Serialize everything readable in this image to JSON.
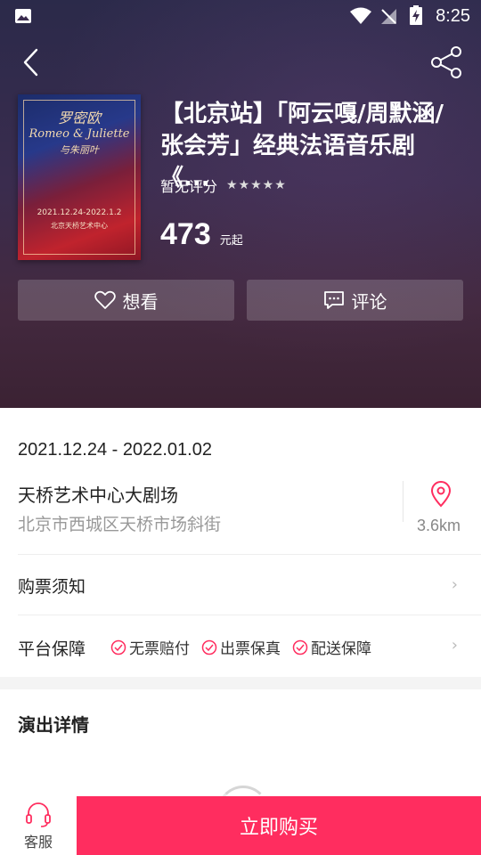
{
  "status_bar": {
    "time": "8:25"
  },
  "show": {
    "title": "【北京站】「阿云嘎/周默涵/张会芳」经典法语音乐剧《...",
    "rating_text": "暂无评分",
    "stars": "★★★★★",
    "price": "473",
    "price_unit": "元起",
    "poster": {
      "title_line1": "罗密欧",
      "title_line2": "Romeo & Juliette",
      "subtitle": "与朱丽叶",
      "date": "2021.12.24-2022.1.2",
      "venue": "北京天桥艺术中心"
    }
  },
  "actions": {
    "want_label": "想看",
    "comment_label": "评论"
  },
  "info": {
    "date_range": "2021.12.24 - 2022.01.02",
    "venue": "天桥艺术中心大剧场",
    "address": "北京市西城区天桥市场斜街",
    "distance": "3.6km",
    "ticket_notice_label": "购票须知",
    "guarantee_label": "平台保障",
    "guarantees": [
      "无票赔付",
      "出票保真",
      "配送保障"
    ],
    "details_title": "演出详情"
  },
  "bottom": {
    "service_label": "客服",
    "buy_label": "立即购买"
  },
  "colors": {
    "accent": "#ff2d5f",
    "hero_bg": "#3a2c4e"
  }
}
